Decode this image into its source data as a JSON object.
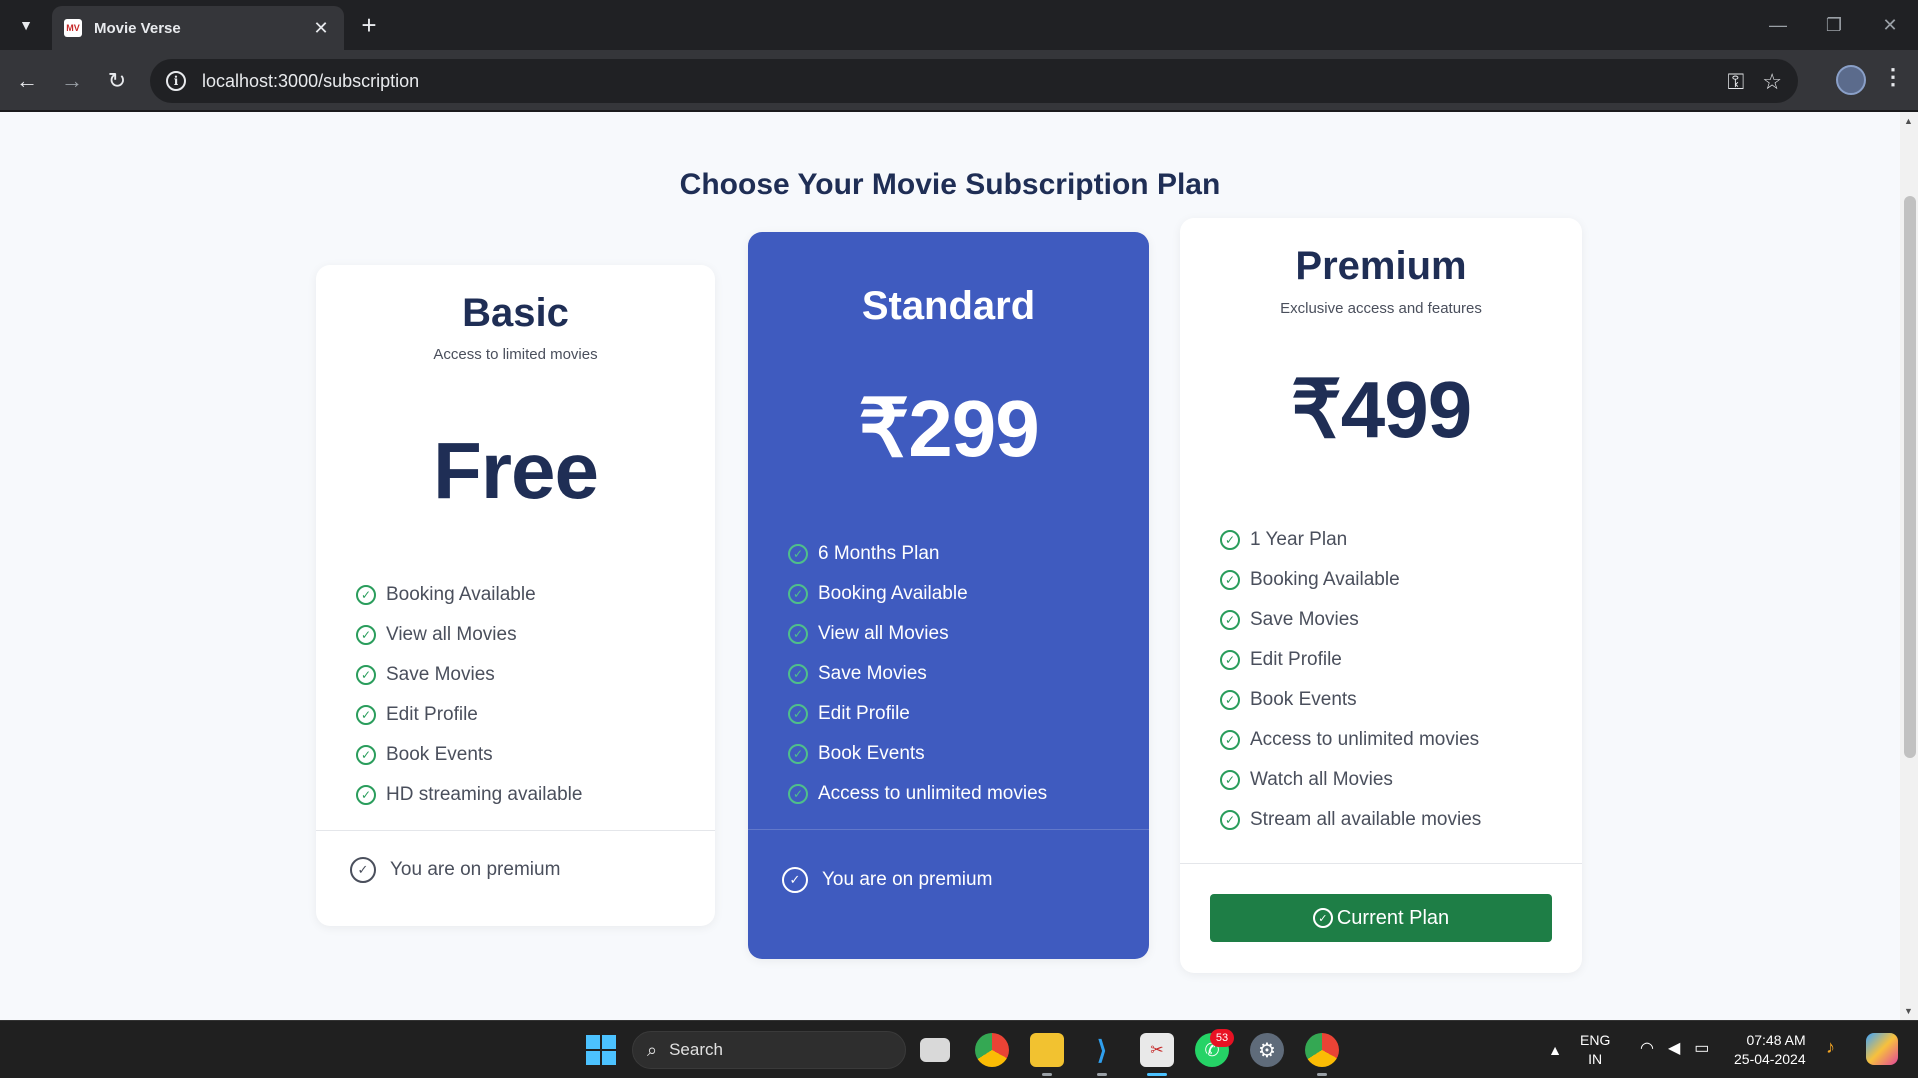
{
  "browser": {
    "tab_title": "Movie Verse",
    "favicon_text": "MV",
    "url": "localhost:3000/subscription"
  },
  "page": {
    "heading": "Choose Your Movie Subscription Plan"
  },
  "plans": {
    "basic": {
      "name": "Basic",
      "description": "Access to limited movies",
      "price": "Free",
      "features": [
        "Booking Available",
        "View all Movies",
        "Save Movies",
        "Edit Profile",
        "Book Events",
        "HD streaming available"
      ],
      "status": "You are on premium"
    },
    "standard": {
      "name": "Standard",
      "price": "₹299",
      "features": [
        "6 Months Plan",
        "Booking Available",
        "View all Movies",
        "Save Movies",
        "Edit Profile",
        "Book Events",
        "Access to unlimited movies"
      ],
      "status": "You are on premium",
      "color": "#3f5bbf"
    },
    "premium": {
      "name": "Premium",
      "description": "Exclusive access and features",
      "price": "₹499",
      "features": [
        "1 Year Plan",
        "Booking Available",
        "Save Movies",
        "Edit Profile",
        "Book Events",
        "Access to unlimited movies",
        "Watch all Movies",
        "Stream all available movies"
      ],
      "button_label": "Current Plan",
      "button_color": "#1e7e46"
    }
  },
  "taskbar": {
    "search_label": "Search",
    "whatsapp_badge": "53",
    "language_line1": "ENG",
    "language_line2": "IN",
    "time": "07:48 AM",
    "date": "25-04-2024"
  }
}
